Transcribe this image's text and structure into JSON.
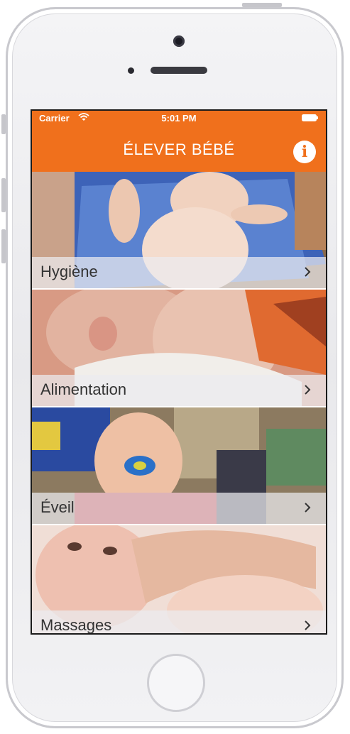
{
  "status_bar": {
    "carrier": "Carrier",
    "time": "5:01 PM"
  },
  "header": {
    "title": "ÉLEVER BÉBÉ",
    "info_glyph": "i",
    "color": "#f0701c"
  },
  "menu": {
    "items": [
      {
        "label": "Hygiène",
        "icon": "chevron-right-icon"
      },
      {
        "label": "Alimentation",
        "icon": "chevron-right-icon"
      },
      {
        "label": "Éveil",
        "icon": "chevron-right-icon"
      },
      {
        "label": "Massages",
        "icon": "chevron-right-icon"
      }
    ]
  }
}
